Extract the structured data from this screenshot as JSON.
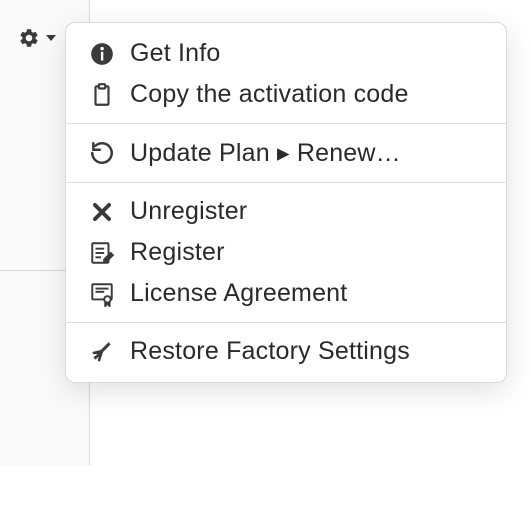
{
  "menu": {
    "groups": [
      [
        {
          "id": "get-info",
          "label": "Get Info",
          "icon": "info-icon"
        },
        {
          "id": "copy-code",
          "label": "Copy the activation code",
          "icon": "clipboard-icon"
        }
      ],
      [
        {
          "id": "update-plan",
          "label": "Update Plan ▸ Renew…",
          "icon": "refresh-icon"
        }
      ],
      [
        {
          "id": "unregister",
          "label": "Unregister",
          "icon": "x-icon"
        },
        {
          "id": "register",
          "label": "Register",
          "icon": "register-icon"
        },
        {
          "id": "license",
          "label": "License Agreement",
          "icon": "certificate-icon"
        }
      ],
      [
        {
          "id": "restore",
          "label": "Restore Factory Settings",
          "icon": "broom-icon"
        }
      ]
    ]
  }
}
